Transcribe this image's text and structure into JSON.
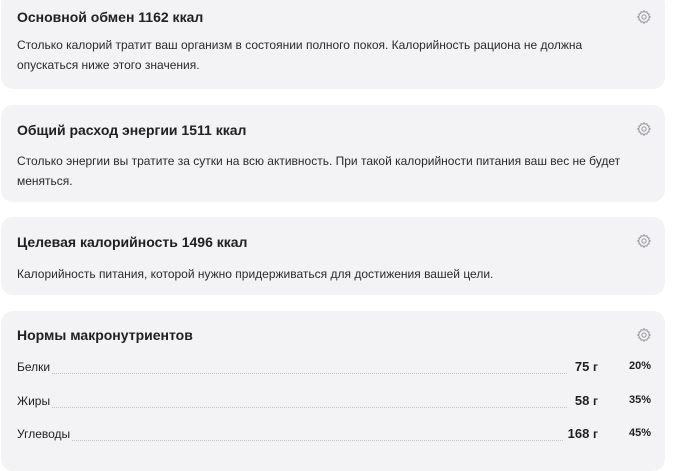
{
  "cards": [
    {
      "title": "Основной обмен 1162 ккал",
      "text": "Столько калорий тратит ваш организм в состоянии полного покоя. Калорийность рациона не должна опускаться ниже этого значения."
    },
    {
      "title": "Общий расход энергии 1511 ккал",
      "text": "Столько энергии вы тратите за сутки на всю активность. При такой калорийности питания ваш вес не будет меняться."
    },
    {
      "title": "Целевая калорийность 1496 ккал",
      "text": "Калорийность питания, которой нужно придерживаться для достижения вашей цели."
    }
  ],
  "macros": {
    "title": "Нормы макронутриентов",
    "items": [
      {
        "name": "Белки",
        "amount": "75",
        "unit": "г",
        "percent": "20%"
      },
      {
        "name": "Жиры",
        "amount": "58",
        "unit": "г",
        "percent": "35%"
      },
      {
        "name": "Углеводы",
        "amount": "168",
        "unit": "г",
        "percent": "45%"
      }
    ]
  },
  "icons": {
    "settings": "gear-icon"
  },
  "colors": {
    "card_background": "#f3f3f5",
    "text": "#1f1f1f",
    "icon": "#9a9aa0"
  }
}
